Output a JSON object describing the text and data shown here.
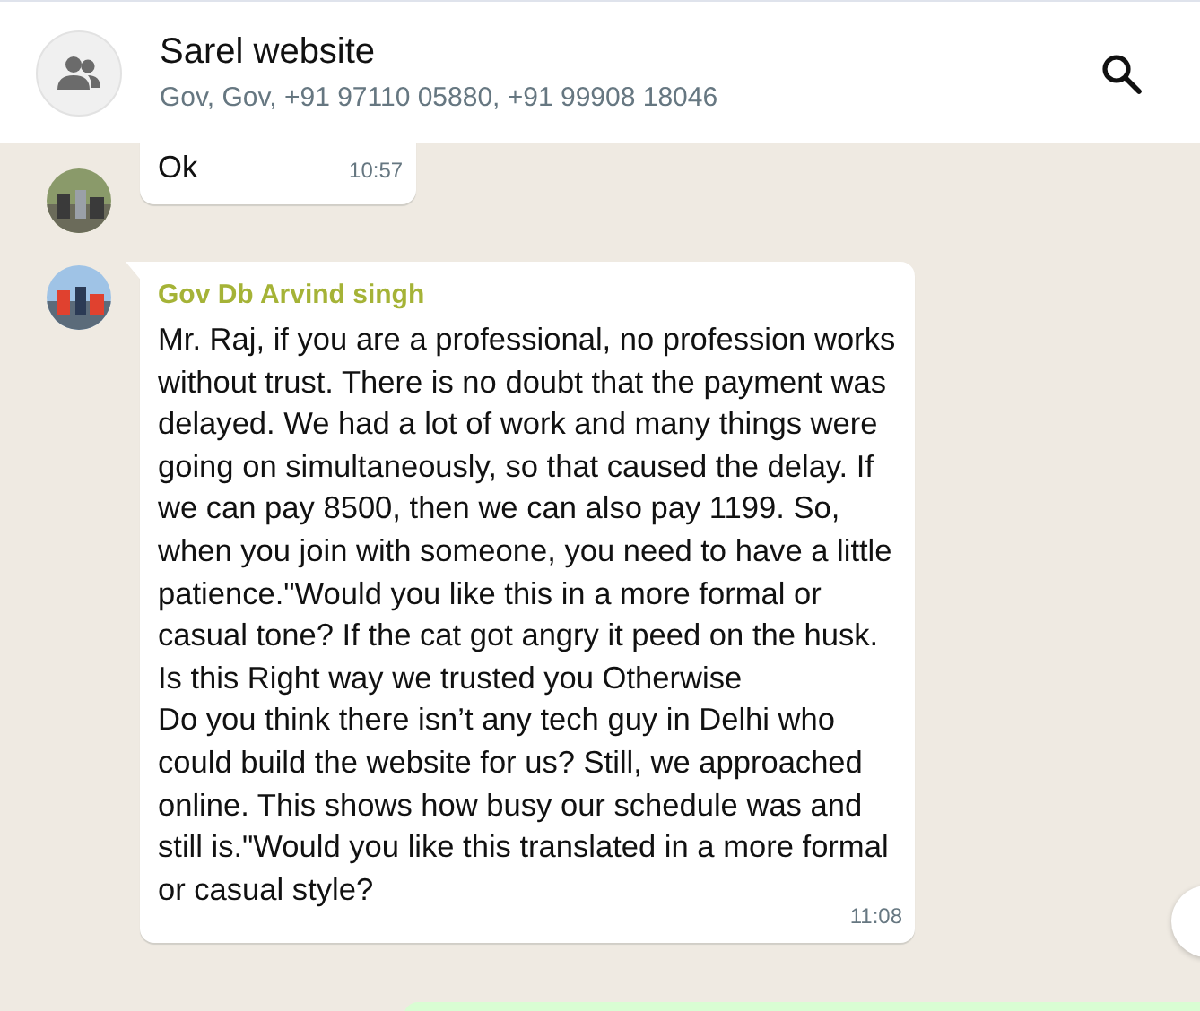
{
  "header": {
    "title": "Sarel website",
    "subtitle": "Gov, Gov, +91 97110 05880, +91 99908 18046"
  },
  "messages": [
    {
      "text": "Ok",
      "time": "10:57"
    },
    {
      "sender": "Gov Db Arvind singh",
      "color": "#a5b337",
      "text": "Mr. Raj, if you are a professional, no profession works without trust. There is no doubt that the payment was delayed. We had a lot of work and many things were going on simultaneously, so that caused the delay. If we can pay 8500, then we can also pay 1199. So, when you join with someone, you need to have a little patience.\"Would you like this in a more formal or casual tone? If the cat got angry it peed on the husk. Is this Right way we trusted you Otherwise\nDo you think there isn’t any tech guy in Delhi who could build the website for us? Still, we approached online. This shows how busy our schedule was and still is.\"Would you like this translated in a more formal or casual style?",
      "time": "11:08"
    }
  ]
}
